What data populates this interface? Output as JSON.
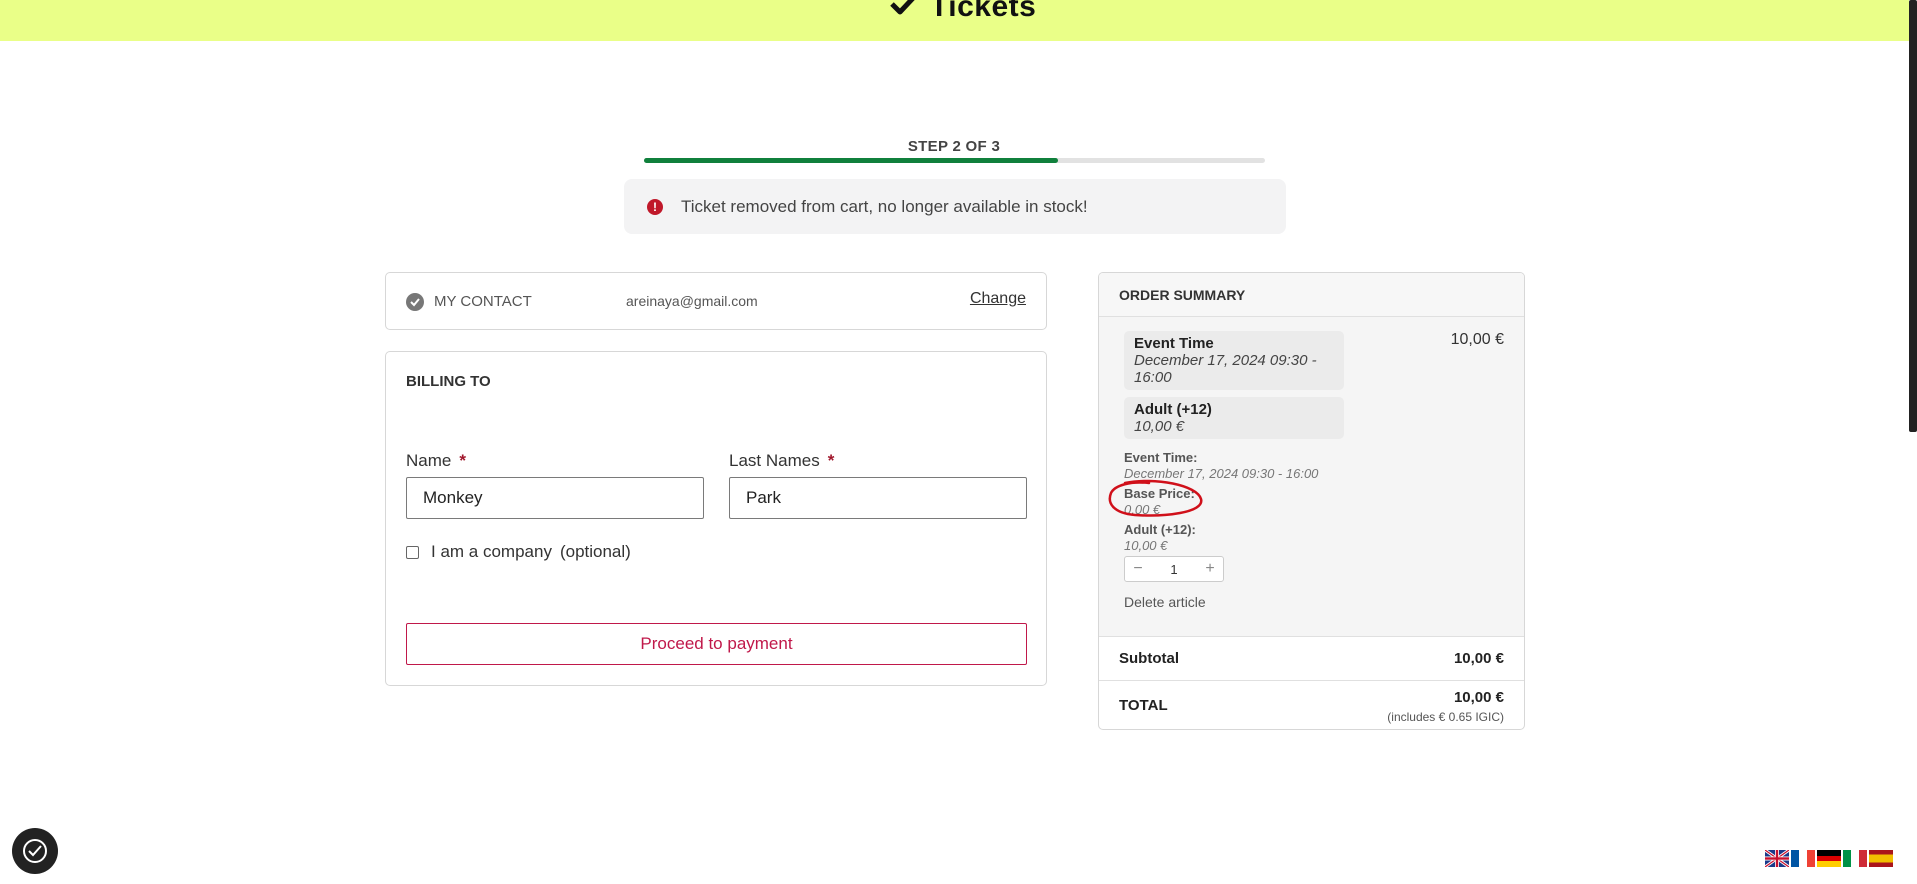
{
  "header": {
    "logo_text": "Tickets",
    "background": "#eaff88"
  },
  "progress": {
    "step_label": "STEP 2 OF 3",
    "fraction": 0.666
  },
  "alert": {
    "text": "Ticket removed from cart, no longer available in stock!",
    "icon": "exclamation-icon"
  },
  "contact": {
    "label": "MY CONTACT",
    "email": "areinaya@gmail.com",
    "change_label": "Change"
  },
  "billing": {
    "title": "BILLING TO",
    "name_label": "Name",
    "name_value": "Monkey",
    "lastname_label": "Last Names",
    "lastname_value": "Park",
    "required_mark": "*",
    "company_label": "I am a company",
    "company_optional": "(optional)",
    "proceed_label": "Proceed to payment"
  },
  "summary": {
    "title": "ORDER SUMMARY",
    "line_price": "10,00 €",
    "event_time_title": "Event Time",
    "event_time_value": "December 17, 2024 09:30 - 16:00",
    "ticket_title": "Adult (+12)",
    "ticket_value": "10,00 €",
    "detail_event_label": "Event Time:",
    "detail_event_value": "December 17, 2024 09:30 - 16:00",
    "detail_base_label": "Base Price:",
    "detail_base_value": "0,00 €",
    "detail_adult_label": "Adult (+12):",
    "detail_adult_value": "10,00 €",
    "quantity": "1",
    "minus": "−",
    "plus": "+",
    "delete_label": "Delete article",
    "subtotal_label": "Subtotal",
    "subtotal_value": "10,00 €",
    "total_label": "TOTAL",
    "total_value": "10,00 €",
    "total_note": "(includes € 0.65  IGIC)"
  },
  "languages": [
    "en",
    "fr",
    "de",
    "it",
    "es"
  ],
  "colors": {
    "accent": "#c0184a",
    "progress": "#10803c",
    "annotation": "#d0101a"
  }
}
